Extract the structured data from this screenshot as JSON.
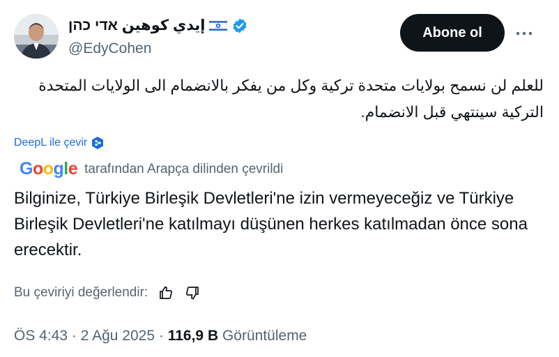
{
  "author": {
    "display_name": "إيدي كوهين אדי כהן",
    "handle": "@EdyCohen",
    "flag_icon": "israel-flag-icon",
    "verified_icon": "verified-badge-icon",
    "verified_color": "#1d9bf0"
  },
  "actions": {
    "follow_label": "Abone ol",
    "more_icon": "more-horizontal-icon"
  },
  "tweet": {
    "text": "للعلم لن نسمح بولايات متحدة تركية وكل من يفكر بالانضمام الى الولايات المتحدة التركية سينتهي قبل الانضمام."
  },
  "deepl": {
    "label": "DeepL ile çevir",
    "icon": "deepl-icon",
    "color": "#1d6cd9"
  },
  "translation": {
    "provider": "Google",
    "source_note": "tarafından Arapça dilinden çevrildi",
    "text": "Bilginize, Türkiye Birleşik Devletleri'ne izin vermeyeceğiz ve Türkiye Birleşik Devletleri'ne katılmayı düşünen herkes katılmadan önce sona erecektir."
  },
  "rating": {
    "label": "Bu çeviriyi değerlendir:",
    "up_icon": "thumbs-up-icon",
    "down_icon": "thumbs-down-icon"
  },
  "meta": {
    "time": "ÖS 4:43",
    "date": "2 Ağu 2025",
    "views_count": "116,9 B",
    "views_label": "Görüntüleme",
    "separator": "·"
  }
}
